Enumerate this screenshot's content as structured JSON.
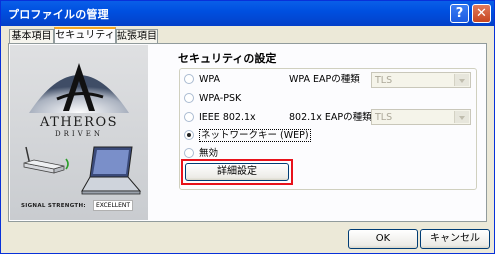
{
  "window": {
    "title": "プロファイルの管理",
    "help_label": "?",
    "close_label": "✕"
  },
  "tabs": [
    {
      "label": "基本項目",
      "active": false
    },
    {
      "label": "セキュリティ",
      "active": true
    },
    {
      "label": "拡張項目",
      "active": false
    }
  ],
  "brand": {
    "name": "ATHEROS",
    "tagline": "DRIVEN",
    "signal_label": "SIGNAL STRENGTH:",
    "signal_value": "EXCELLENT",
    "icons": [
      "atheros-logo-icon",
      "wireless-router-icon",
      "laptop-icon"
    ]
  },
  "security": {
    "title": "セキュリティの設定",
    "options": [
      {
        "label": "WPA",
        "checked": false
      },
      {
        "label": "WPA-PSK",
        "checked": false
      },
      {
        "label": "IEEE 802.1x",
        "checked": false
      },
      {
        "label": "ネットワークキー (WEP)",
        "checked": true
      },
      {
        "label": "無効",
        "checked": false
      }
    ],
    "wpa_eap_label": "WPA EAPの種類",
    "wpa_eap_value": "TLS",
    "x8021_eap_label": "802.1x EAPの種類",
    "x8021_eap_value": "TLS",
    "detail_button": "詳細設定",
    "highlight_color": "#e8121b"
  },
  "footer": {
    "ok_label": "OK",
    "cancel_label": "キャンセル"
  }
}
